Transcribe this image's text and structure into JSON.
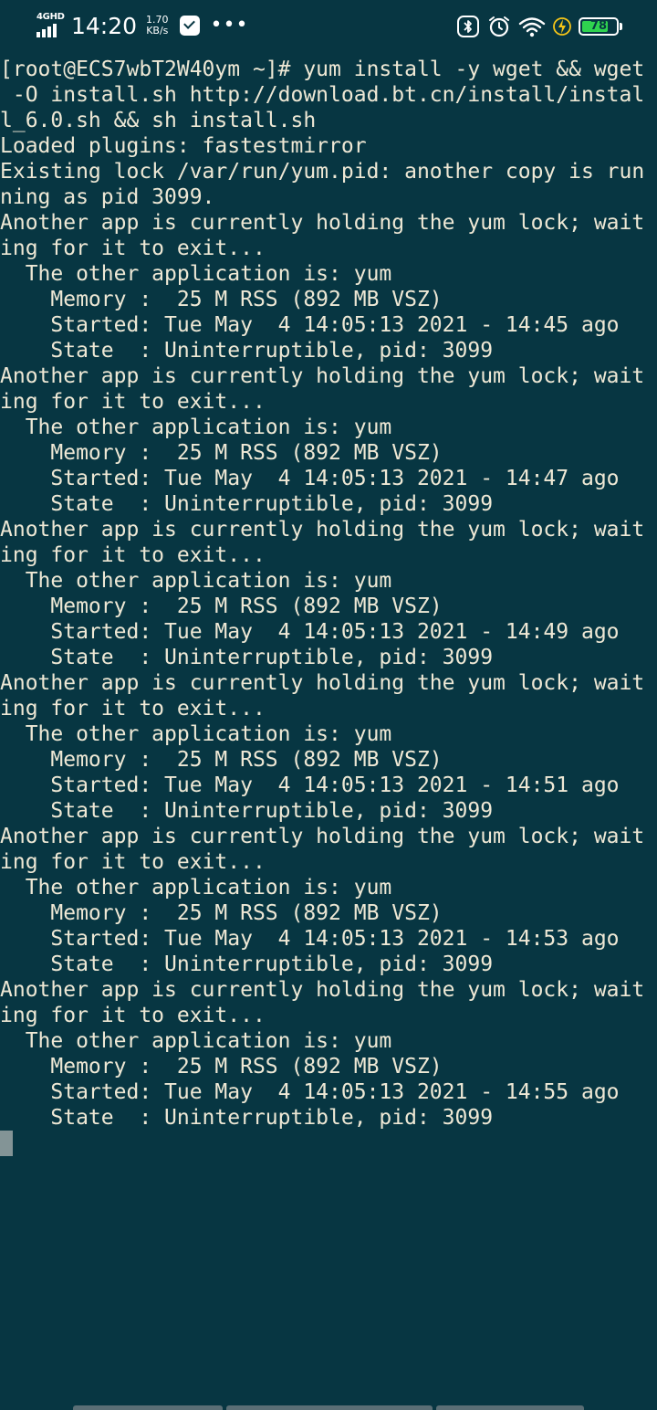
{
  "status_bar": {
    "network_type": "4GHD",
    "time": "14:20",
    "net_speed_value": "1.70",
    "net_speed_unit": "KB/s",
    "more_indicator": "•••",
    "battery_level": 78,
    "battery_text": "78",
    "icons": [
      "signal-icon",
      "message-icon",
      "bluetooth-icon",
      "alarm-icon",
      "wifi-icon",
      "charging-icon",
      "battery-icon"
    ]
  },
  "terminal": {
    "lines": [
      "[root@ECS7wbT2W40ym ~]# yum install -y wget && wget",
      " -O install.sh http://download.bt.cn/install/instal",
      "l_6.0.sh && sh install.sh",
      "Loaded plugins: fastestmirror",
      "Existing lock /var/run/yum.pid: another copy is run",
      "ning as pid 3099.",
      "Another app is currently holding the yum lock; wait",
      "ing for it to exit...",
      "  The other application is: yum",
      "    Memory :  25 M RSS (892 MB VSZ)",
      "    Started: Tue May  4 14:05:13 2021 - 14:45 ago",
      "    State  : Uninterruptible, pid: 3099",
      "Another app is currently holding the yum lock; wait",
      "ing for it to exit...",
      "  The other application is: yum",
      "    Memory :  25 M RSS (892 MB VSZ)",
      "    Started: Tue May  4 14:05:13 2021 - 14:47 ago",
      "    State  : Uninterruptible, pid: 3099",
      "Another app is currently holding the yum lock; wait",
      "ing for it to exit...",
      "  The other application is: yum",
      "    Memory :  25 M RSS (892 MB VSZ)",
      "    Started: Tue May  4 14:05:13 2021 - 14:49 ago",
      "    State  : Uninterruptible, pid: 3099",
      "Another app is currently holding the yum lock; wait",
      "ing for it to exit...",
      "  The other application is: yum",
      "    Memory :  25 M RSS (892 MB VSZ)",
      "    Started: Tue May  4 14:05:13 2021 - 14:51 ago",
      "    State  : Uninterruptible, pid: 3099",
      "Another app is currently holding the yum lock; wait",
      "ing for it to exit...",
      "  The other application is: yum",
      "    Memory :  25 M RSS (892 MB VSZ)",
      "    Started: Tue May  4 14:05:13 2021 - 14:53 ago",
      "    State  : Uninterruptible, pid: 3099",
      "Another app is currently holding the yum lock; wait",
      "ing for it to exit...",
      "  The other application is: yum",
      "    Memory :  25 M RSS (892 MB VSZ)",
      "    Started: Tue May  4 14:05:13 2021 - 14:55 ago",
      "    State  : Uninterruptible, pid: 3099"
    ]
  },
  "colors": {
    "background": "#073642",
    "foreground": "#eee8d5",
    "cursor": "#839496",
    "battery_fill": "#2fd34f"
  }
}
